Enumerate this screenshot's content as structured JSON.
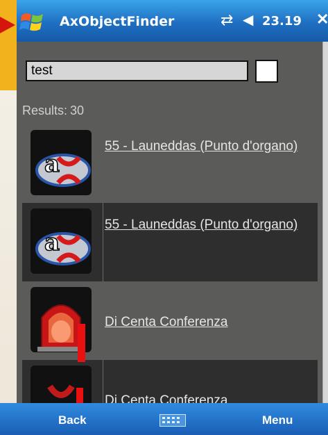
{
  "titlebar": {
    "app_title": "AxObjectFinder",
    "time": "23.19",
    "sync_icon": "sync-icon",
    "volume_icon": "volume-icon",
    "close_label": "✕"
  },
  "search": {
    "value": "test"
  },
  "results": {
    "label": "Results:",
    "count": "30",
    "items": [
      {
        "title": "55 - Launeddas (Punto d'organo)",
        "icon": "ax-logo-icon"
      },
      {
        "title": "55 - Launeddas (Punto d'organo)",
        "icon": "ax-logo-icon"
      },
      {
        "title": "Di Centa Conferenza",
        "icon": "siren-icon"
      },
      {
        "title": "Di Centa Conferenza",
        "icon": "ax-logo-icon"
      }
    ]
  },
  "softkeys": {
    "left": "Back",
    "right": "Menu",
    "keyboard_icon": "keyboard-icon"
  },
  "colors": {
    "titlebar": "#1f6fc2",
    "panel": "#5b5b59",
    "alt_row": "#2e2e2e",
    "annotation": "#e81010"
  }
}
